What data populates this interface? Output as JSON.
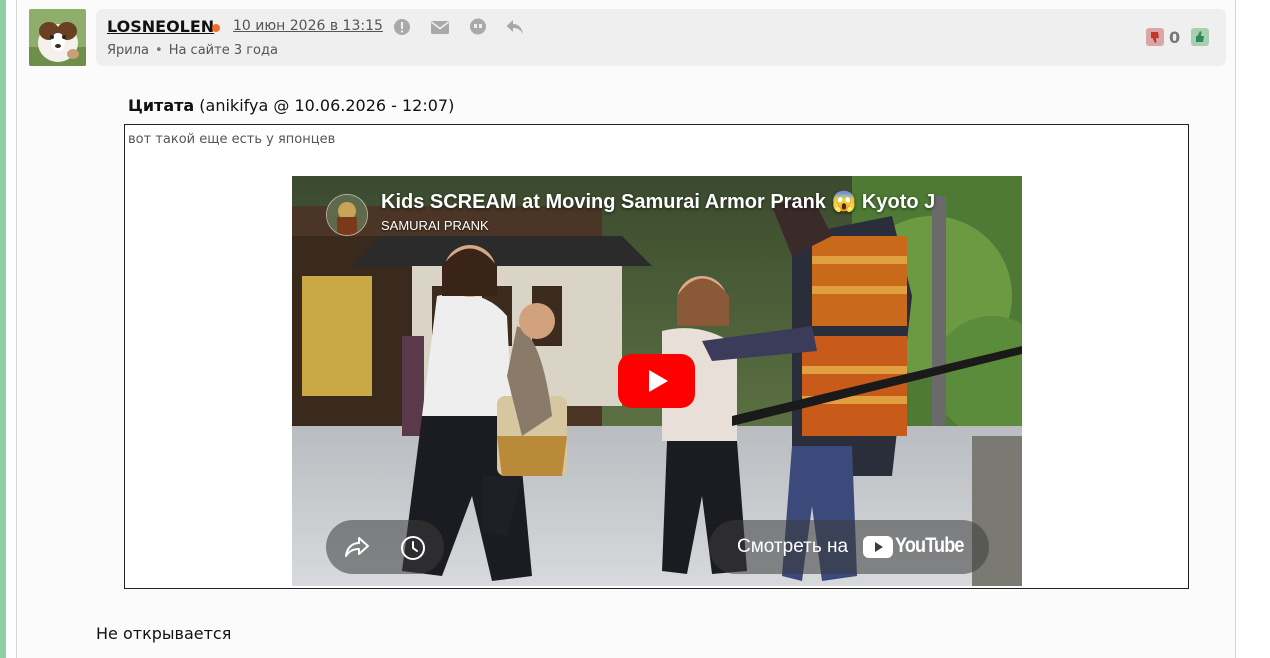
{
  "post": {
    "username": "LOSNEOLEN",
    "date": "10 июн 2026 в 13:15",
    "role": "Ярила",
    "bullet": "•",
    "member_since": "На сайте 3 года",
    "rating": "0",
    "status_color": "#f26d21",
    "icons": [
      "alert-icon",
      "mail-icon",
      "quote-icon",
      "reply-icon",
      "dislike-icon",
      "like-icon"
    ]
  },
  "quote": {
    "label": "Цитата",
    "source": "(anikifya @ 10.06.2026 - 12:07)",
    "text": "вот такой еще есть у японцев"
  },
  "video": {
    "title": "Kids SCREAM at Moving Samurai Armor Prank 😱 Kyoto J",
    "channel": "SAMURAI PRANK",
    "watch_label": "Смотреть на",
    "yt_logo": "YouTube",
    "accent": "#ff0000"
  },
  "reply": {
    "text": "Не открывается"
  }
}
